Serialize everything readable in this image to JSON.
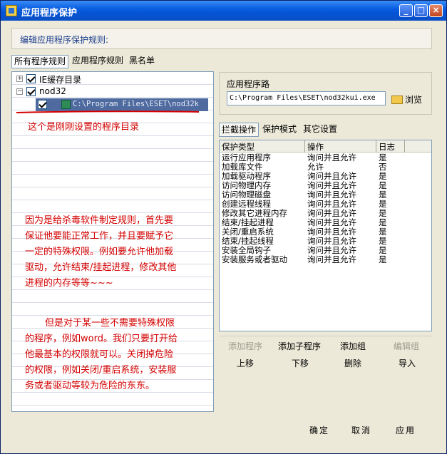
{
  "window": {
    "title": "应用程序保护",
    "header": "编辑应用程序保护规则:",
    "buttons": {
      "minimize": "_",
      "maximize": "□",
      "close": "×"
    }
  },
  "top_tabs": [
    "所有程序规则",
    "应用程序规则",
    "黑名单"
  ],
  "tree": {
    "items": [
      {
        "label": "IE缓存目录",
        "expander": "+"
      },
      {
        "label": "nod32",
        "expander": "−"
      }
    ],
    "selected_path": "C:\\Program Files\\ESET\\nod32k"
  },
  "annotations": {
    "caption": "这个是刚刚设置的程序目录",
    "para1": [
      "因为是给杀毒软件制定规则，首先要",
      "保证他要能正常工作，并且要赋予它",
      "一定的特殊权限。例如要允许他加载",
      "驱动，允许结束/挂起进程，修改其他",
      "进程的内存等等~~~"
    ],
    "para2": [
      "但是对于某一些不需要特殊权限",
      "的程序，例如word。我们只要打开给",
      "他最基本的权限就可以。关闭掉危险",
      "的权限，例如关闭/重启系统，安装服",
      "务或者驱动等较为危险的东东。"
    ]
  },
  "path_group": {
    "label": "应用程序路",
    "value": "C:\\Program Files\\ESET\\nod32kui.exe",
    "browse": "浏览"
  },
  "sub_tabs": [
    "拦截操作",
    "保护模式",
    "其它设置"
  ],
  "grid": {
    "columns": [
      "保护类型",
      "操作",
      "日志"
    ],
    "rows": [
      [
        "运行应用程序",
        "询问并且允许",
        "是"
      ],
      [
        "加载库文件",
        "允许",
        "否"
      ],
      [
        "加载驱动程序",
        "询问并且允许",
        "是"
      ],
      [
        "访问物理内存",
        "询问并且允许",
        "是"
      ],
      [
        "访问物理磁盘",
        "询问并且允许",
        "是"
      ],
      [
        "创建远程线程",
        "询问并且允许",
        "是"
      ],
      [
        "修改其它进程内存",
        "询问并且允许",
        "是"
      ],
      [
        "结束/挂起进程",
        "询问并且允许",
        "是"
      ],
      [
        "关闭/重启系统",
        "询问并且允许",
        "是"
      ],
      [
        "结束/挂起线程",
        "询问并且允许",
        "是"
      ],
      [
        "安装全局钩子",
        "询问并且允许",
        "是"
      ],
      [
        "安装服务或者驱动",
        "询问并且允许",
        "是"
      ]
    ]
  },
  "actions": {
    "add_program": "添加程序",
    "add_child": "添加子程序",
    "add_group": "添加组",
    "edit_group": "编辑组",
    "move_up": "上移",
    "move_down": "下移",
    "delete": "删除",
    "import": "导入"
  },
  "dialog": {
    "ok": "确定",
    "cancel": "取消",
    "apply": "应用"
  }
}
